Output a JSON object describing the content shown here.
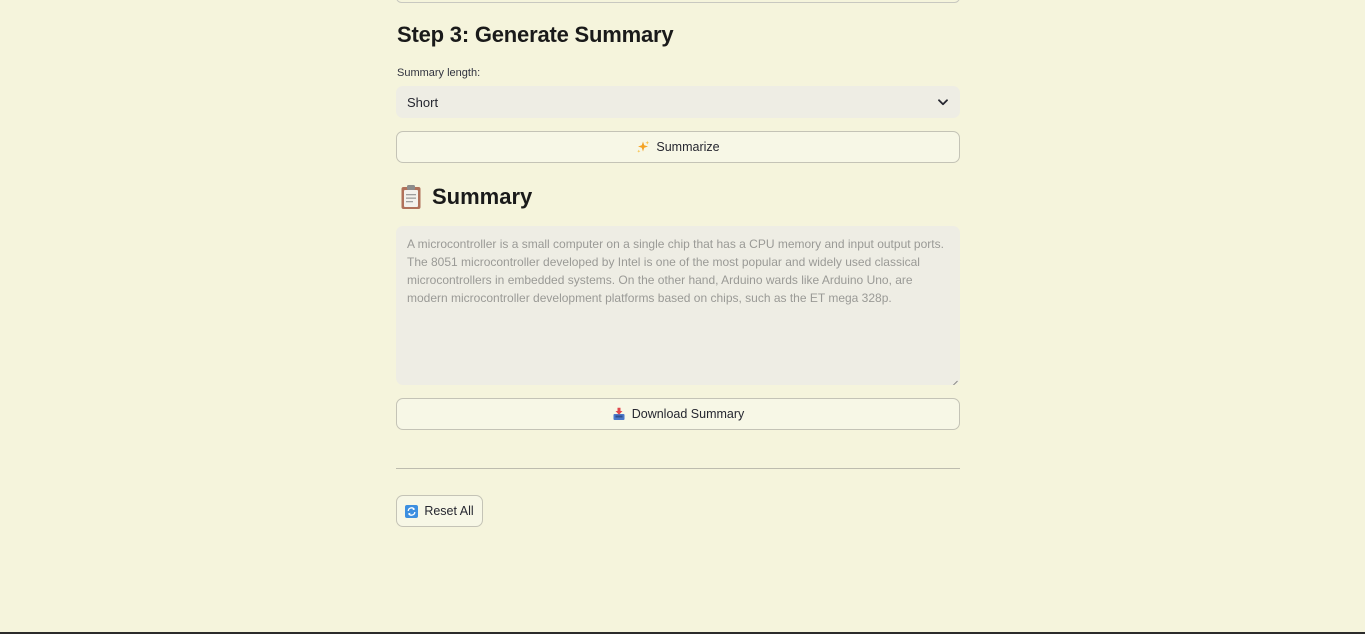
{
  "step": {
    "title": "Step 3: Generate Summary"
  },
  "summary_length": {
    "label": "Summary length:",
    "selected": "Short"
  },
  "buttons": {
    "summarize": "Summarize",
    "download": "Download Summary",
    "reset": "Reset All"
  },
  "summary": {
    "heading": "Summary",
    "text": "A microcontroller is a small computer on a single chip that has a CPU memory and input output ports. The 8051 microcontroller developed by Intel is one of the most popular and widely used classical microcontrollers in embedded systems. On the other hand, Arduino wards like Arduino Uno, are modern microcontroller development platforms based on chips, such as the ET mega 328p."
  },
  "icons": {
    "summarize": "sparkles-icon",
    "summary_heading": "clipboard-icon",
    "download": "inbox-tray-icon",
    "reset": "counterclockwise-arrows-icon",
    "select": "chevron-down-icon"
  },
  "colors": {
    "background": "#f5f4dc",
    "input_background": "#eeede4",
    "button_background": "#f7f7e6",
    "border": "#c4c3b6"
  }
}
